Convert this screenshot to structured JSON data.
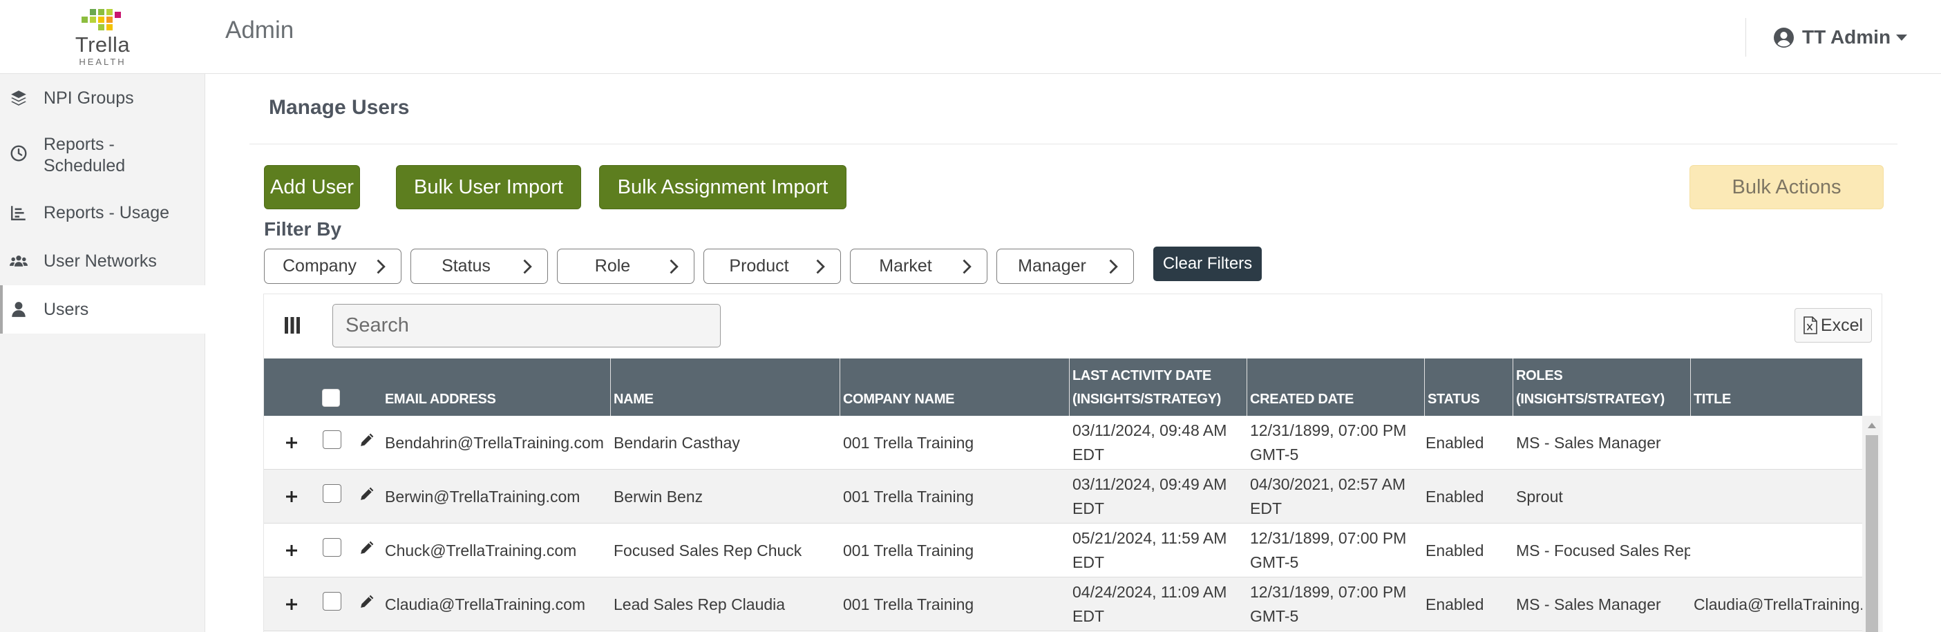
{
  "logo": {
    "word": "Trella",
    "sub": "HEALTH"
  },
  "header": {
    "title": "Admin",
    "user_name": "TT Admin"
  },
  "sidebar": {
    "items": [
      {
        "label": "NPI Groups",
        "icon": "layers-icon"
      },
      {
        "label": "Reports - Scheduled",
        "icon": "clock-icon"
      },
      {
        "label": "Reports - Usage",
        "icon": "bar-chart-icon"
      },
      {
        "label": "User Networks",
        "icon": "users-icon"
      },
      {
        "label": "Users",
        "icon": "user-icon",
        "active": true
      }
    ]
  },
  "main": {
    "title": "Manage Users",
    "buttons": {
      "add_user": "Add User",
      "bulk_user_import": "Bulk User Import",
      "bulk_assignment_import": "Bulk Assignment Import",
      "bulk_actions": "Bulk Actions"
    },
    "filter_label": "Filter By",
    "filters": [
      "Company",
      "Status",
      "Role",
      "Product",
      "Market",
      "Manager"
    ],
    "clear_filters": "Clear Filters",
    "search_placeholder": "Search",
    "excel_label": "Excel"
  },
  "table": {
    "headers": {
      "email": "EMAIL ADDRESS",
      "name": "NAME",
      "company": "COMPANY NAME",
      "last_activity_1": "LAST ACTIVITY DATE",
      "last_activity_2": "(INSIGHTS/STRATEGY)",
      "created": "CREATED DATE",
      "status": "STATUS",
      "roles_1": "ROLES",
      "roles_2": "(INSIGHTS/STRATEGY)",
      "title": "TITLE"
    },
    "rows": [
      {
        "email": "Bendahrin@TrellaTraining.com",
        "name": "Bendarin Casthay",
        "company": "001 Trella Training",
        "last_activity_1": "03/11/2024, 09:48 AM",
        "last_activity_2": "EDT",
        "created_1": "12/31/1899, 07:00 PM",
        "created_2": "GMT-5",
        "status": "Enabled",
        "roles": "MS - Sales Manager",
        "title": ""
      },
      {
        "email": "Berwin@TrellaTraining.com",
        "name": "Berwin Benz",
        "company": "001 Trella Training",
        "last_activity_1": "03/11/2024, 09:49 AM",
        "last_activity_2": "EDT",
        "created_1": "04/30/2021, 02:57 AM",
        "created_2": "EDT",
        "status": "Enabled",
        "roles": "Sprout",
        "title": ""
      },
      {
        "email": "Chuck@TrellaTraining.com",
        "name": "Focused Sales Rep Chuck",
        "company": "001 Trella Training",
        "last_activity_1": "05/21/2024, 11:59 AM",
        "last_activity_2": "EDT",
        "created_1": "12/31/1899, 07:00 PM",
        "created_2": "GMT-5",
        "status": "Enabled",
        "roles": "MS - Focused Sales Rep",
        "title": ""
      },
      {
        "email": "Claudia@TrellaTraining.com",
        "name": "Lead Sales Rep Claudia",
        "company": "001 Trella Training",
        "last_activity_1": "04/24/2024, 11:09 AM",
        "last_activity_2": "EDT",
        "created_1": "12/31/1899, 07:00 PM",
        "created_2": "GMT-5",
        "status": "Enabled",
        "roles": "MS - Sales Manager",
        "title": "Claudia@TrellaTraining.c"
      }
    ]
  },
  "colors": {
    "accent_green": "#5d7e1f",
    "bulk_actions_bg": "#fbe9b6",
    "table_header_bg": "#5a6770",
    "clear_filters_bg": "#2c3b46",
    "sidebar_bg": "#f3f3f3"
  }
}
